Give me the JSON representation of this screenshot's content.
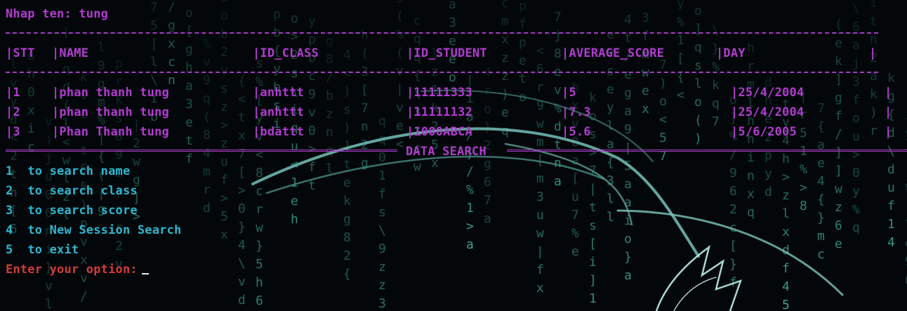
{
  "prompt_name": "Nhap ten: tung",
  "table": {
    "headers": [
      "|STT",
      "|NAME",
      "|ID_CLASS",
      "|ID_STUDENT",
      "|AVERAGE_SCORE",
      "|DAY",
      "|"
    ],
    "rows": [
      [
        "|1",
        "|phan thanh tung",
        "|anhttt",
        "|11111333",
        "|5",
        "|25/4/2004",
        "|"
      ],
      [
        "|2",
        "|phan thanh tung",
        "|anhttt",
        "|11111132",
        "|7.3",
        "|25/4/2004",
        "|"
      ],
      [
        "|3",
        "|Phan Thanh tung",
        "|bdattt",
        "|1000ABCA",
        "|5.6",
        "|5/6/2005",
        "|"
      ]
    ]
  },
  "search_banner": "DATA SEARCH",
  "menu": [
    {
      "num": "1",
      "text": "to search name"
    },
    {
      "num": "2",
      "text": "to search class"
    },
    {
      "num": "3",
      "text": "to search score"
    },
    {
      "num": "4",
      "text": "to New Session Search"
    },
    {
      "num": "5",
      "text": "to exit"
    }
  ],
  "option_prompt": "Enter your option:",
  "colors": {
    "background": "#03070a",
    "table_text": "#b23bd0",
    "menu_text": "#2fb6cf",
    "prompt_text": "#d43a3a",
    "matrix_rain": "#3fa894"
  },
  "background_art": [
    "matrix-rain",
    "kali-dragon-logo"
  ]
}
